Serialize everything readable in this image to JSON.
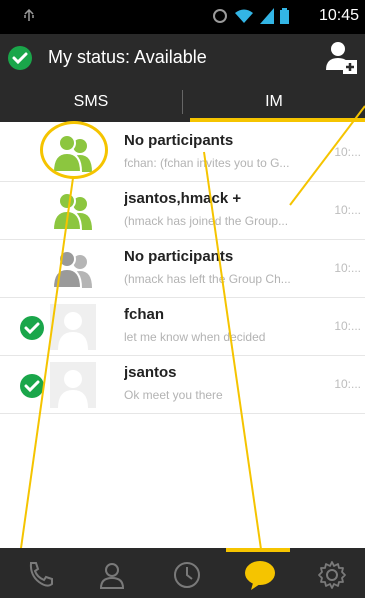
{
  "status_bar": {
    "time": "10:45",
    "icons": [
      "usb-icon",
      "sync-icon",
      "wifi-icon",
      "signal-icon",
      "battery-icon"
    ]
  },
  "app_bar": {
    "title": "My status: Available",
    "status_icon": "available-check-icon",
    "action_icon": "add-contact-icon"
  },
  "tabs": [
    {
      "label": "SMS",
      "selected": false
    },
    {
      "label": "IM",
      "selected": true
    }
  ],
  "conversations": [
    {
      "name": "No participants",
      "preview": "fchan: (fchan invites you to G...",
      "time": "10:...",
      "avatar": "group-avatar-green",
      "status_check": false
    },
    {
      "name": "jsantos,hmack +",
      "preview": "(hmack has joined the Group...",
      "time": "10:...",
      "avatar": "group-avatar-green",
      "status_check": false
    },
    {
      "name": "No participants",
      "preview": "(hmack has left the Group Ch...",
      "time": "10:...",
      "avatar": "group-avatar-gray",
      "status_check": false
    },
    {
      "name": "fchan",
      "preview": "let me know when decided",
      "time": "10:...",
      "avatar": "contact-avatar-placeholder",
      "status_check": true
    },
    {
      "name": "jsantos",
      "preview": "Ok meet you there",
      "time": "10:...",
      "avatar": "contact-avatar-placeholder",
      "status_check": true
    }
  ],
  "bottom_nav": {
    "items": [
      "phone-icon",
      "contacts-icon",
      "history-icon",
      "chat-icon",
      "settings-icon"
    ],
    "selected": "chat-icon"
  },
  "colors": {
    "accent": "#f5c400",
    "available": "#1aa64a",
    "bar_bg": "#2a2a2a",
    "group_green": "#8cc63f",
    "group_gray": "#9a9a9a"
  }
}
